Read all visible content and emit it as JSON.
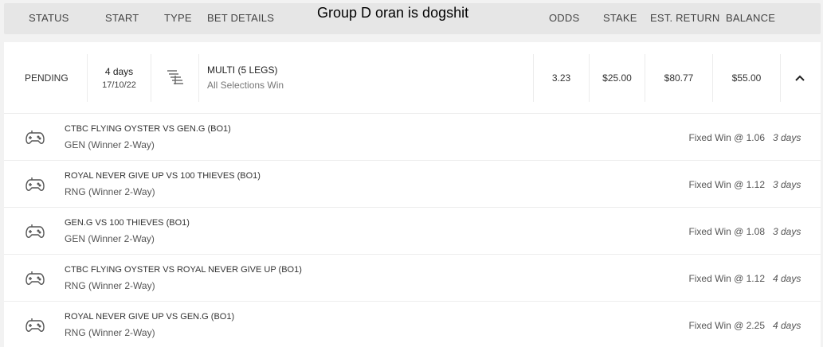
{
  "header": {
    "status": "STATUS",
    "start": "START",
    "type": "TYPE",
    "bet_details": "BET DETAILS",
    "odds": "ODDS",
    "stake": "STAKE",
    "est_return": "EST. RETURN",
    "balance": "BALANCE"
  },
  "overlay_caption": "Group D oran is dogshit",
  "bet": {
    "status": "PENDING",
    "start_relative": "4 days",
    "start_date": "17/10/22",
    "type_icon": "multi-bet-icon",
    "title": "MULTI (5 LEGS)",
    "subtitle": "All Selections Win",
    "odds": "3.23",
    "stake": "$25.00",
    "est_return": "$80.77",
    "balance": "$55.00",
    "toggle_icon": "chevron-up-icon"
  },
  "legs": [
    {
      "match": "CTBC FLYING OYSTER VS GEN.G (BO1)",
      "selection": "GEN (Winner 2-Way)",
      "price": "Fixed Win @ 1.06",
      "ago": "3 days"
    },
    {
      "match": "ROYAL NEVER GIVE UP VS 100 THIEVES (BO1)",
      "selection": "RNG (Winner 2-Way)",
      "price": "Fixed Win @ 1.12",
      "ago": "3 days"
    },
    {
      "match": "GEN.G VS 100 THIEVES (BO1)",
      "selection": "GEN (Winner 2-Way)",
      "price": "Fixed Win @ 1.08",
      "ago": "3 days"
    },
    {
      "match": "CTBC FLYING OYSTER VS ROYAL NEVER GIVE UP (BO1)",
      "selection": "RNG (Winner 2-Way)",
      "price": "Fixed Win @ 1.12",
      "ago": "4 days"
    },
    {
      "match": "ROYAL NEVER GIVE UP VS GEN.G (BO1)",
      "selection": "RNG (Winner 2-Way)",
      "price": "Fixed Win @ 2.25",
      "ago": "4 days"
    }
  ],
  "leg_icon": "gamepad-icon"
}
